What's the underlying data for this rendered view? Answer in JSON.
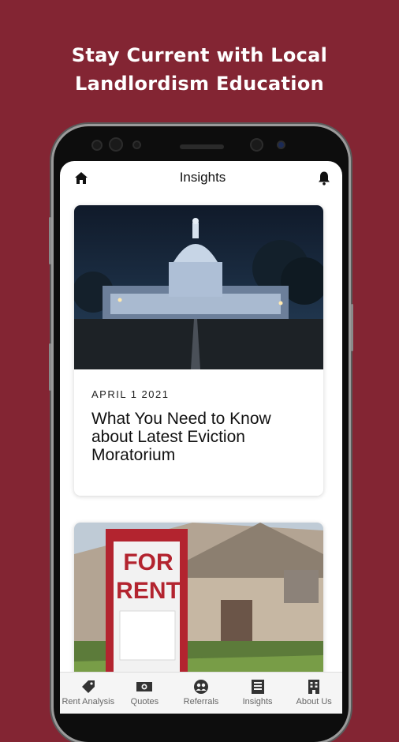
{
  "promo": {
    "line1": "Stay Current with Local",
    "line2": "Landlordism Education"
  },
  "header": {
    "title": "Insights",
    "left_icon": "home-icon",
    "right_icon": "bell-icon"
  },
  "articles": [
    {
      "date": "APRIL 1 2021",
      "headline": "What You Need to Know about Latest Eviction Moratorium",
      "image": "capitol-building-at-night"
    },
    {
      "date": "",
      "headline": "",
      "image": "for-rent-sign-house",
      "sign_line1": "FOR",
      "sign_line2": "RENT"
    }
  ],
  "nav": {
    "items": [
      {
        "label": "Rent Analysis",
        "icon": "tag-icon"
      },
      {
        "label": "Quotes",
        "icon": "money-icon"
      },
      {
        "label": "Referrals",
        "icon": "referrals-icon"
      },
      {
        "label": "Insights",
        "icon": "document-icon"
      },
      {
        "label": "About Us",
        "icon": "building-icon"
      }
    ]
  },
  "colors": {
    "background": "#832533",
    "sign_red": "#b3242f"
  }
}
